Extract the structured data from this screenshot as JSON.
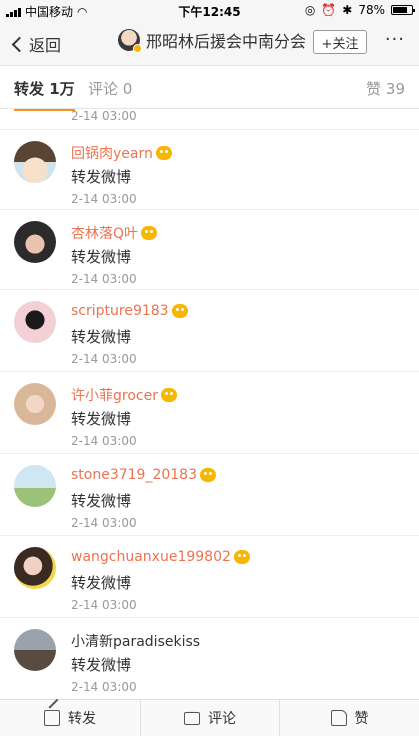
{
  "status_bar": {
    "carrier": "中国移动",
    "time": "下午12:45",
    "battery": "78%"
  },
  "nav": {
    "back_label": "返回",
    "title": "邢昭林后援会中南分会",
    "follow_label": "+关注",
    "more_label": "···"
  },
  "tabs": {
    "repost": "转发 1万",
    "comment": "评论 0",
    "like": "赞 39"
  },
  "feed": {
    "partial_time": "2-14 03:00",
    "items": [
      {
        "name": "回锅肉yearn",
        "text": "转发微博",
        "time": "2-14 03:00"
      },
      {
        "name": "杏林落Q叶",
        "text": "转发微博",
        "time": "2-14 03:00"
      },
      {
        "name": "scripture9183",
        "text": "转发微博",
        "time": "2-14 03:00"
      },
      {
        "name": "许小菲grocer",
        "text": "转发微博",
        "time": "2-14 03:00"
      },
      {
        "name": "stone3719_20183",
        "text": "转发微博",
        "time": "2-14 03:00"
      },
      {
        "name": "wangchuanxue199802",
        "text": "转发微博",
        "time": "2-14 03:00"
      },
      {
        "name": "小清新paradisekiss",
        "text": "转发微博",
        "time": "2-14 03:00"
      }
    ]
  },
  "bottom_bar": {
    "repost": "转发",
    "comment": "评论",
    "like": "赞"
  },
  "colors": {
    "accent": "#f68f28",
    "username": "#eb7350",
    "vip_badge": "#f7b600"
  }
}
